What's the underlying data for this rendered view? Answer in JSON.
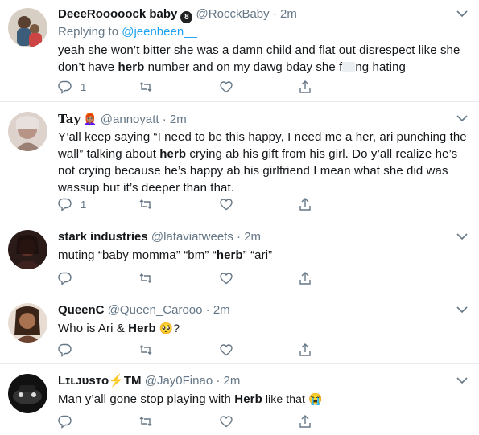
{
  "tweets": [
    {
      "name": "DeeeRooooock baby",
      "badge": "8",
      "handle": "@RocckBaby",
      "dot": "·",
      "time": "2m",
      "replying_prefix": "Replying to ",
      "replying_to": "@jeenbeen__",
      "text_parts": [
        "yeah she won’t bitter she was a damn child and flat out disrespect like she don’t have ",
        "herb",
        " number and on my dawg bday she f",
        "ng hating"
      ],
      "reply_count": "1",
      "avatar_color": "#6b5a4a"
    },
    {
      "name": "Tay",
      "emoji": "👩🏽‍🦰",
      "handle": "@annoyatt",
      "dot": "·",
      "time": "2m",
      "text_parts": [
        "Y’all keep saying “I need to be this happy, I need me a her, ari punching the wall” talking about ",
        "herb",
        " crying ab his gift from his girl. Do y’all realize he’s not crying because he’s happy ab his girlfriend I mean what she did was wassup but it’s deeper than that."
      ],
      "reply_count": "1",
      "avatar_color": "#c9a79b"
    },
    {
      "name": "stark industries",
      "handle": "@lataviatweets",
      "dot": "·",
      "time": "2m",
      "text_parts": [
        "muting “baby momma” “bm” “",
        "herb",
        "” “ari”"
      ],
      "reply_count": "",
      "avatar_color": "#3a2520"
    },
    {
      "name": "QueenC",
      "handle": "@Queen_Carooo",
      "dot": "·",
      "time": "2m",
      "text_parts": [
        "Who is Ari & ",
        "Herb",
        " 🥺?"
      ],
      "reply_count": "",
      "avatar_color": "#8a5a3c"
    },
    {
      "name": "Lɪʟᴊᴜsᴛᴏ⚡TM",
      "handle": "@Jay0Finao",
      "dot": "·",
      "time": "2m",
      "text_parts": [
        "Man y’all gone stop playing with ",
        "Herb",
        " like that 😭"
      ],
      "reply_count": "",
      "avatar_color": "#1c1c1c"
    }
  ],
  "colors": {
    "text": "#14171a",
    "secondary": "#657786",
    "link": "#1da1f2",
    "border": "#e6ecf0"
  },
  "icons": [
    "reply-icon",
    "retweet-icon",
    "like-icon",
    "share-icon",
    "chevron-down-icon"
  ]
}
